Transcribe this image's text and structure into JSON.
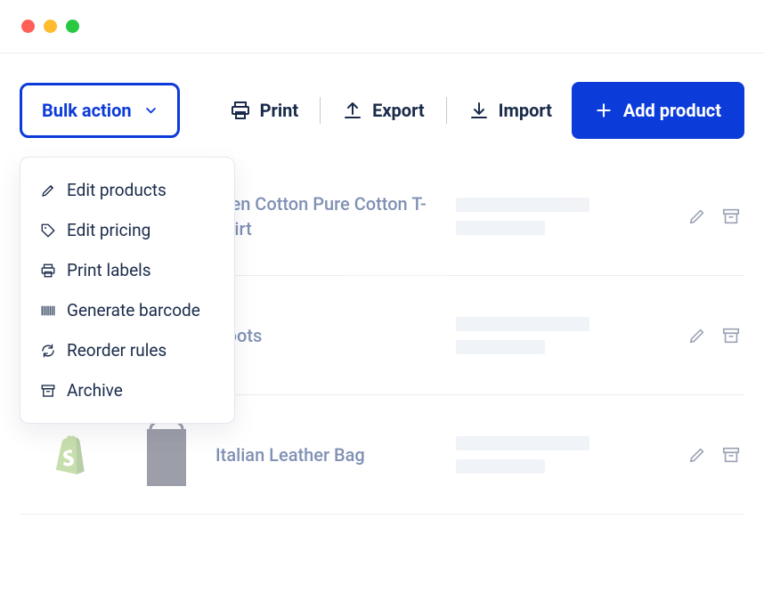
{
  "toolbar": {
    "bulk_label": "Bulk action",
    "print": "Print",
    "export": "Export",
    "import": "Import",
    "add": "Add product"
  },
  "dropdown": {
    "edit_products": "Edit products",
    "edit_pricing": "Edit pricing",
    "print_labels": "Print labels",
    "generate_barcode": "Generate barcode",
    "reorder_rules": "Reorder rules",
    "archive": "Archive"
  },
  "rows": [
    {
      "name": "Men Cotton Pure Cotton T-shirt"
    },
    {
      "name": "Boots"
    },
    {
      "name": "Italian Leather Bag"
    }
  ]
}
